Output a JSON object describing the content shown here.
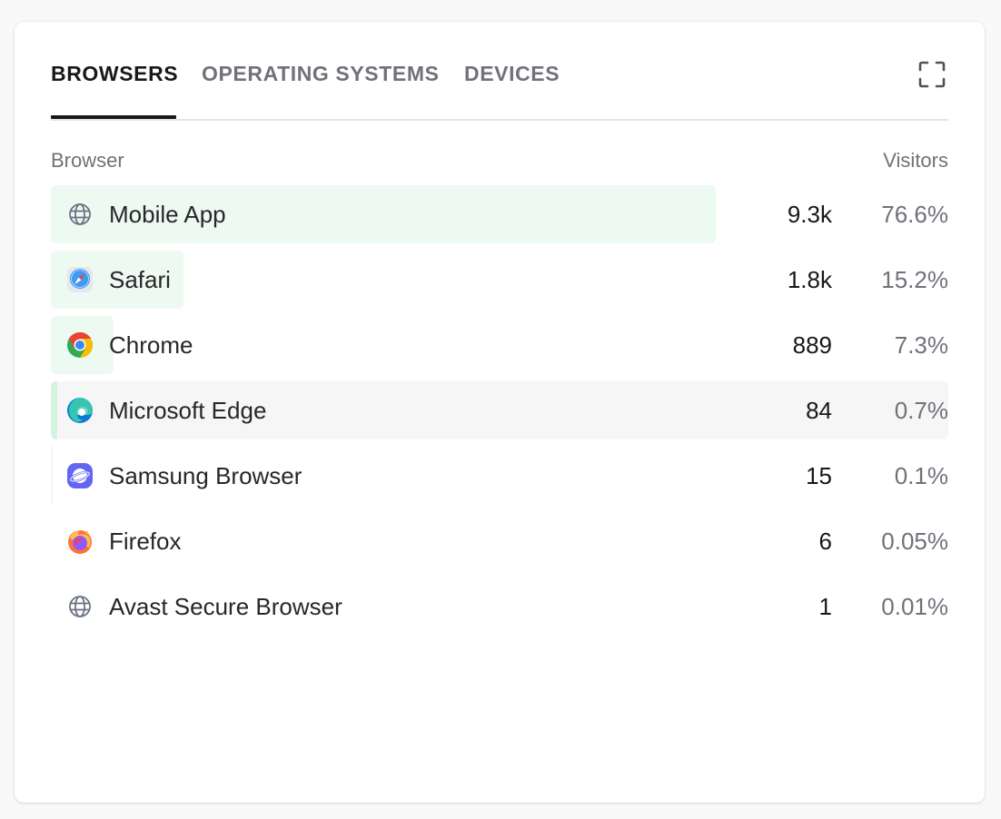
{
  "tabs": [
    {
      "label": "BROWSERS",
      "active": true
    },
    {
      "label": "OPERATING SYSTEMS",
      "active": false
    },
    {
      "label": "DEVICES",
      "active": false
    }
  ],
  "table": {
    "header_left": "Browser",
    "header_right": "Visitors",
    "bar_color": "#ecfaf1",
    "rows": [
      {
        "label": "Mobile App",
        "count": "9.3k",
        "percent": "76.6%",
        "icon": "globe-icon"
      },
      {
        "label": "Safari",
        "count": "1.8k",
        "percent": "15.2%",
        "icon": "safari-icon"
      },
      {
        "label": "Chrome",
        "count": "889",
        "percent": "7.3%",
        "icon": "chrome-icon"
      },
      {
        "label": "Microsoft Edge",
        "count": "84",
        "percent": "0.7%",
        "icon": "edge-icon"
      },
      {
        "label": "Samsung Browser",
        "count": "15",
        "percent": "0.1%",
        "icon": "samsung-browser-icon"
      },
      {
        "label": "Firefox",
        "count": "6",
        "percent": "0.05%",
        "icon": "firefox-icon"
      },
      {
        "label": "Avast Secure Browser",
        "count": "1",
        "percent": "0.01%",
        "icon": "globe-icon"
      }
    ]
  }
}
